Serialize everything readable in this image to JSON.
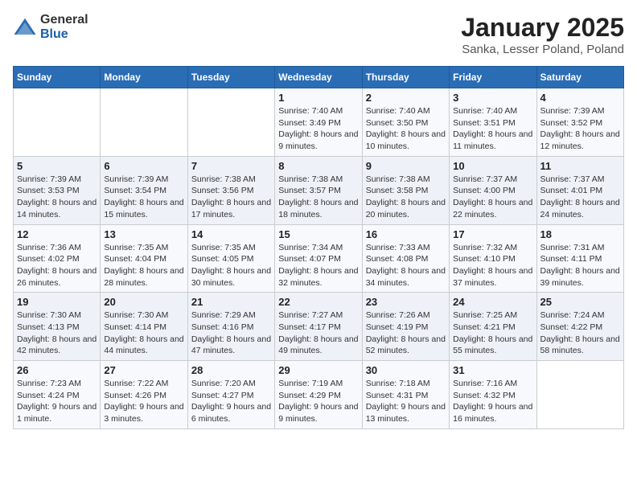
{
  "logo": {
    "general": "General",
    "blue": "Blue"
  },
  "title": "January 2025",
  "subtitle": "Sanka, Lesser Poland, Poland",
  "headers": [
    "Sunday",
    "Monday",
    "Tuesday",
    "Wednesday",
    "Thursday",
    "Friday",
    "Saturday"
  ],
  "weeks": [
    [
      {
        "day": "",
        "info": ""
      },
      {
        "day": "",
        "info": ""
      },
      {
        "day": "",
        "info": ""
      },
      {
        "day": "1",
        "info": "Sunrise: 7:40 AM\nSunset: 3:49 PM\nDaylight: 8 hours and 9 minutes."
      },
      {
        "day": "2",
        "info": "Sunrise: 7:40 AM\nSunset: 3:50 PM\nDaylight: 8 hours and 10 minutes."
      },
      {
        "day": "3",
        "info": "Sunrise: 7:40 AM\nSunset: 3:51 PM\nDaylight: 8 hours and 11 minutes."
      },
      {
        "day": "4",
        "info": "Sunrise: 7:39 AM\nSunset: 3:52 PM\nDaylight: 8 hours and 12 minutes."
      }
    ],
    [
      {
        "day": "5",
        "info": "Sunrise: 7:39 AM\nSunset: 3:53 PM\nDaylight: 8 hours and 14 minutes."
      },
      {
        "day": "6",
        "info": "Sunrise: 7:39 AM\nSunset: 3:54 PM\nDaylight: 8 hours and 15 minutes."
      },
      {
        "day": "7",
        "info": "Sunrise: 7:38 AM\nSunset: 3:56 PM\nDaylight: 8 hours and 17 minutes."
      },
      {
        "day": "8",
        "info": "Sunrise: 7:38 AM\nSunset: 3:57 PM\nDaylight: 8 hours and 18 minutes."
      },
      {
        "day": "9",
        "info": "Sunrise: 7:38 AM\nSunset: 3:58 PM\nDaylight: 8 hours and 20 minutes."
      },
      {
        "day": "10",
        "info": "Sunrise: 7:37 AM\nSunset: 4:00 PM\nDaylight: 8 hours and 22 minutes."
      },
      {
        "day": "11",
        "info": "Sunrise: 7:37 AM\nSunset: 4:01 PM\nDaylight: 8 hours and 24 minutes."
      }
    ],
    [
      {
        "day": "12",
        "info": "Sunrise: 7:36 AM\nSunset: 4:02 PM\nDaylight: 8 hours and 26 minutes."
      },
      {
        "day": "13",
        "info": "Sunrise: 7:35 AM\nSunset: 4:04 PM\nDaylight: 8 hours and 28 minutes."
      },
      {
        "day": "14",
        "info": "Sunrise: 7:35 AM\nSunset: 4:05 PM\nDaylight: 8 hours and 30 minutes."
      },
      {
        "day": "15",
        "info": "Sunrise: 7:34 AM\nSunset: 4:07 PM\nDaylight: 8 hours and 32 minutes."
      },
      {
        "day": "16",
        "info": "Sunrise: 7:33 AM\nSunset: 4:08 PM\nDaylight: 8 hours and 34 minutes."
      },
      {
        "day": "17",
        "info": "Sunrise: 7:32 AM\nSunset: 4:10 PM\nDaylight: 8 hours and 37 minutes."
      },
      {
        "day": "18",
        "info": "Sunrise: 7:31 AM\nSunset: 4:11 PM\nDaylight: 8 hours and 39 minutes."
      }
    ],
    [
      {
        "day": "19",
        "info": "Sunrise: 7:30 AM\nSunset: 4:13 PM\nDaylight: 8 hours and 42 minutes."
      },
      {
        "day": "20",
        "info": "Sunrise: 7:30 AM\nSunset: 4:14 PM\nDaylight: 8 hours and 44 minutes."
      },
      {
        "day": "21",
        "info": "Sunrise: 7:29 AM\nSunset: 4:16 PM\nDaylight: 8 hours and 47 minutes."
      },
      {
        "day": "22",
        "info": "Sunrise: 7:27 AM\nSunset: 4:17 PM\nDaylight: 8 hours and 49 minutes."
      },
      {
        "day": "23",
        "info": "Sunrise: 7:26 AM\nSunset: 4:19 PM\nDaylight: 8 hours and 52 minutes."
      },
      {
        "day": "24",
        "info": "Sunrise: 7:25 AM\nSunset: 4:21 PM\nDaylight: 8 hours and 55 minutes."
      },
      {
        "day": "25",
        "info": "Sunrise: 7:24 AM\nSunset: 4:22 PM\nDaylight: 8 hours and 58 minutes."
      }
    ],
    [
      {
        "day": "26",
        "info": "Sunrise: 7:23 AM\nSunset: 4:24 PM\nDaylight: 9 hours and 1 minute."
      },
      {
        "day": "27",
        "info": "Sunrise: 7:22 AM\nSunset: 4:26 PM\nDaylight: 9 hours and 3 minutes."
      },
      {
        "day": "28",
        "info": "Sunrise: 7:20 AM\nSunset: 4:27 PM\nDaylight: 9 hours and 6 minutes."
      },
      {
        "day": "29",
        "info": "Sunrise: 7:19 AM\nSunset: 4:29 PM\nDaylight: 9 hours and 9 minutes."
      },
      {
        "day": "30",
        "info": "Sunrise: 7:18 AM\nSunset: 4:31 PM\nDaylight: 9 hours and 13 minutes."
      },
      {
        "day": "31",
        "info": "Sunrise: 7:16 AM\nSunset: 4:32 PM\nDaylight: 9 hours and 16 minutes."
      },
      {
        "day": "",
        "info": ""
      }
    ]
  ]
}
